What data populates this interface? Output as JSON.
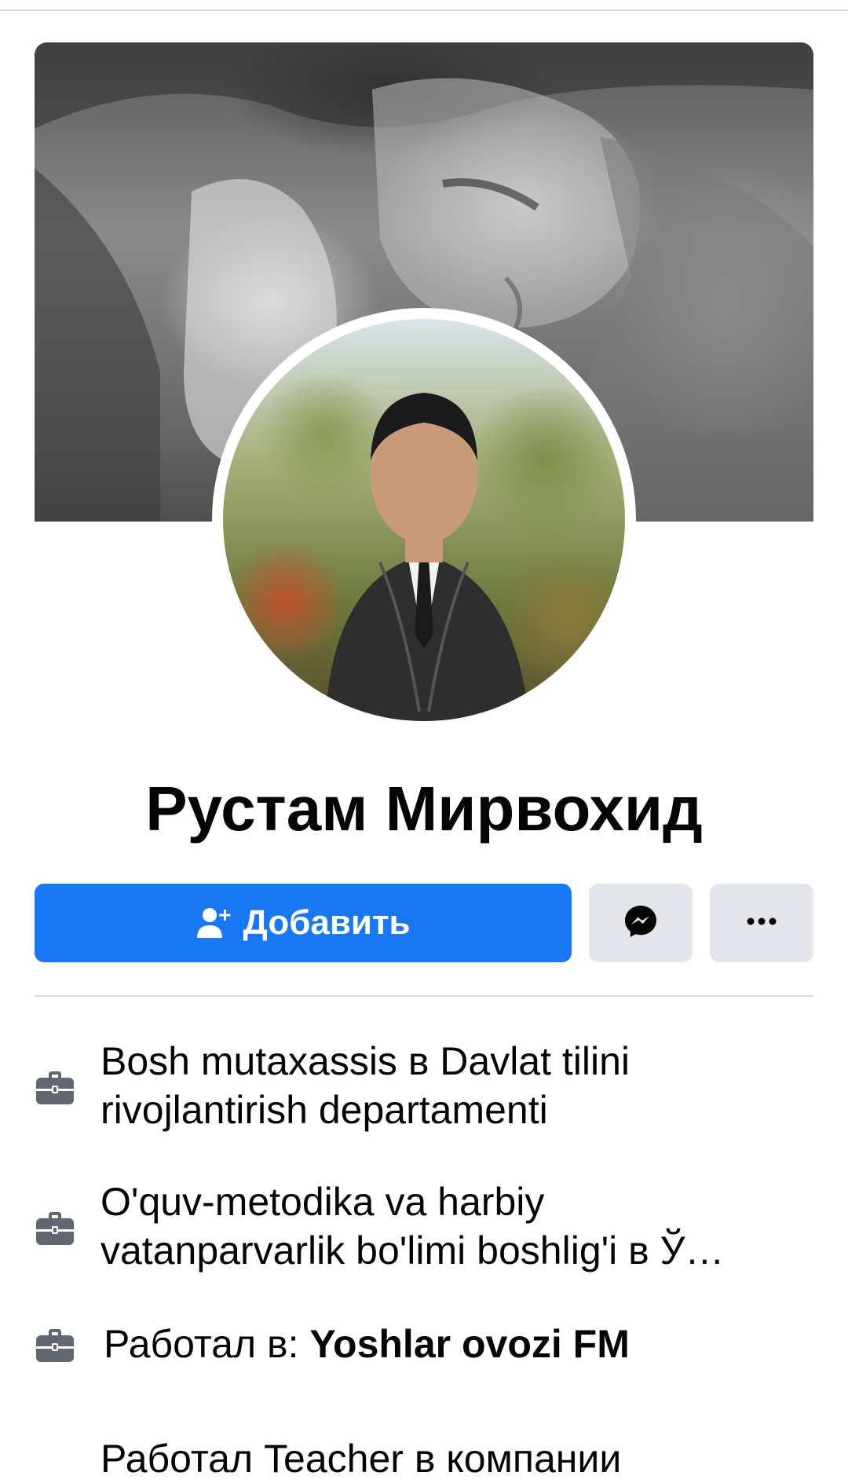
{
  "profile": {
    "name": "Рустам Мирвохид"
  },
  "actions": {
    "add_friend_label": "Добавить",
    "add_friend_icon": "add-friend-icon",
    "messenger_icon": "messenger-icon",
    "more_icon": "more-horizontal-icon"
  },
  "work": [
    {
      "icon": "briefcase-icon",
      "text": "Bosh mutaxassis в Davlat tilini rivojlantirish departamenti"
    },
    {
      "icon": "briefcase-icon",
      "text": "O'quv-metodika va harbiy vatanparvarlik bo'limi boshlig'i в Ў…"
    },
    {
      "icon": "briefcase-icon",
      "prefix": "Работал в: ",
      "company": "Yoshlar ovozi FM"
    },
    {
      "icon": "briefcase-icon",
      "text": "Работал Teacher в компании"
    }
  ],
  "colors": {
    "primary_button": "#1877f2",
    "secondary_button": "#e4e6eb",
    "icon_gray": "#606770",
    "divider": "#dadde1",
    "text": "#050505"
  }
}
